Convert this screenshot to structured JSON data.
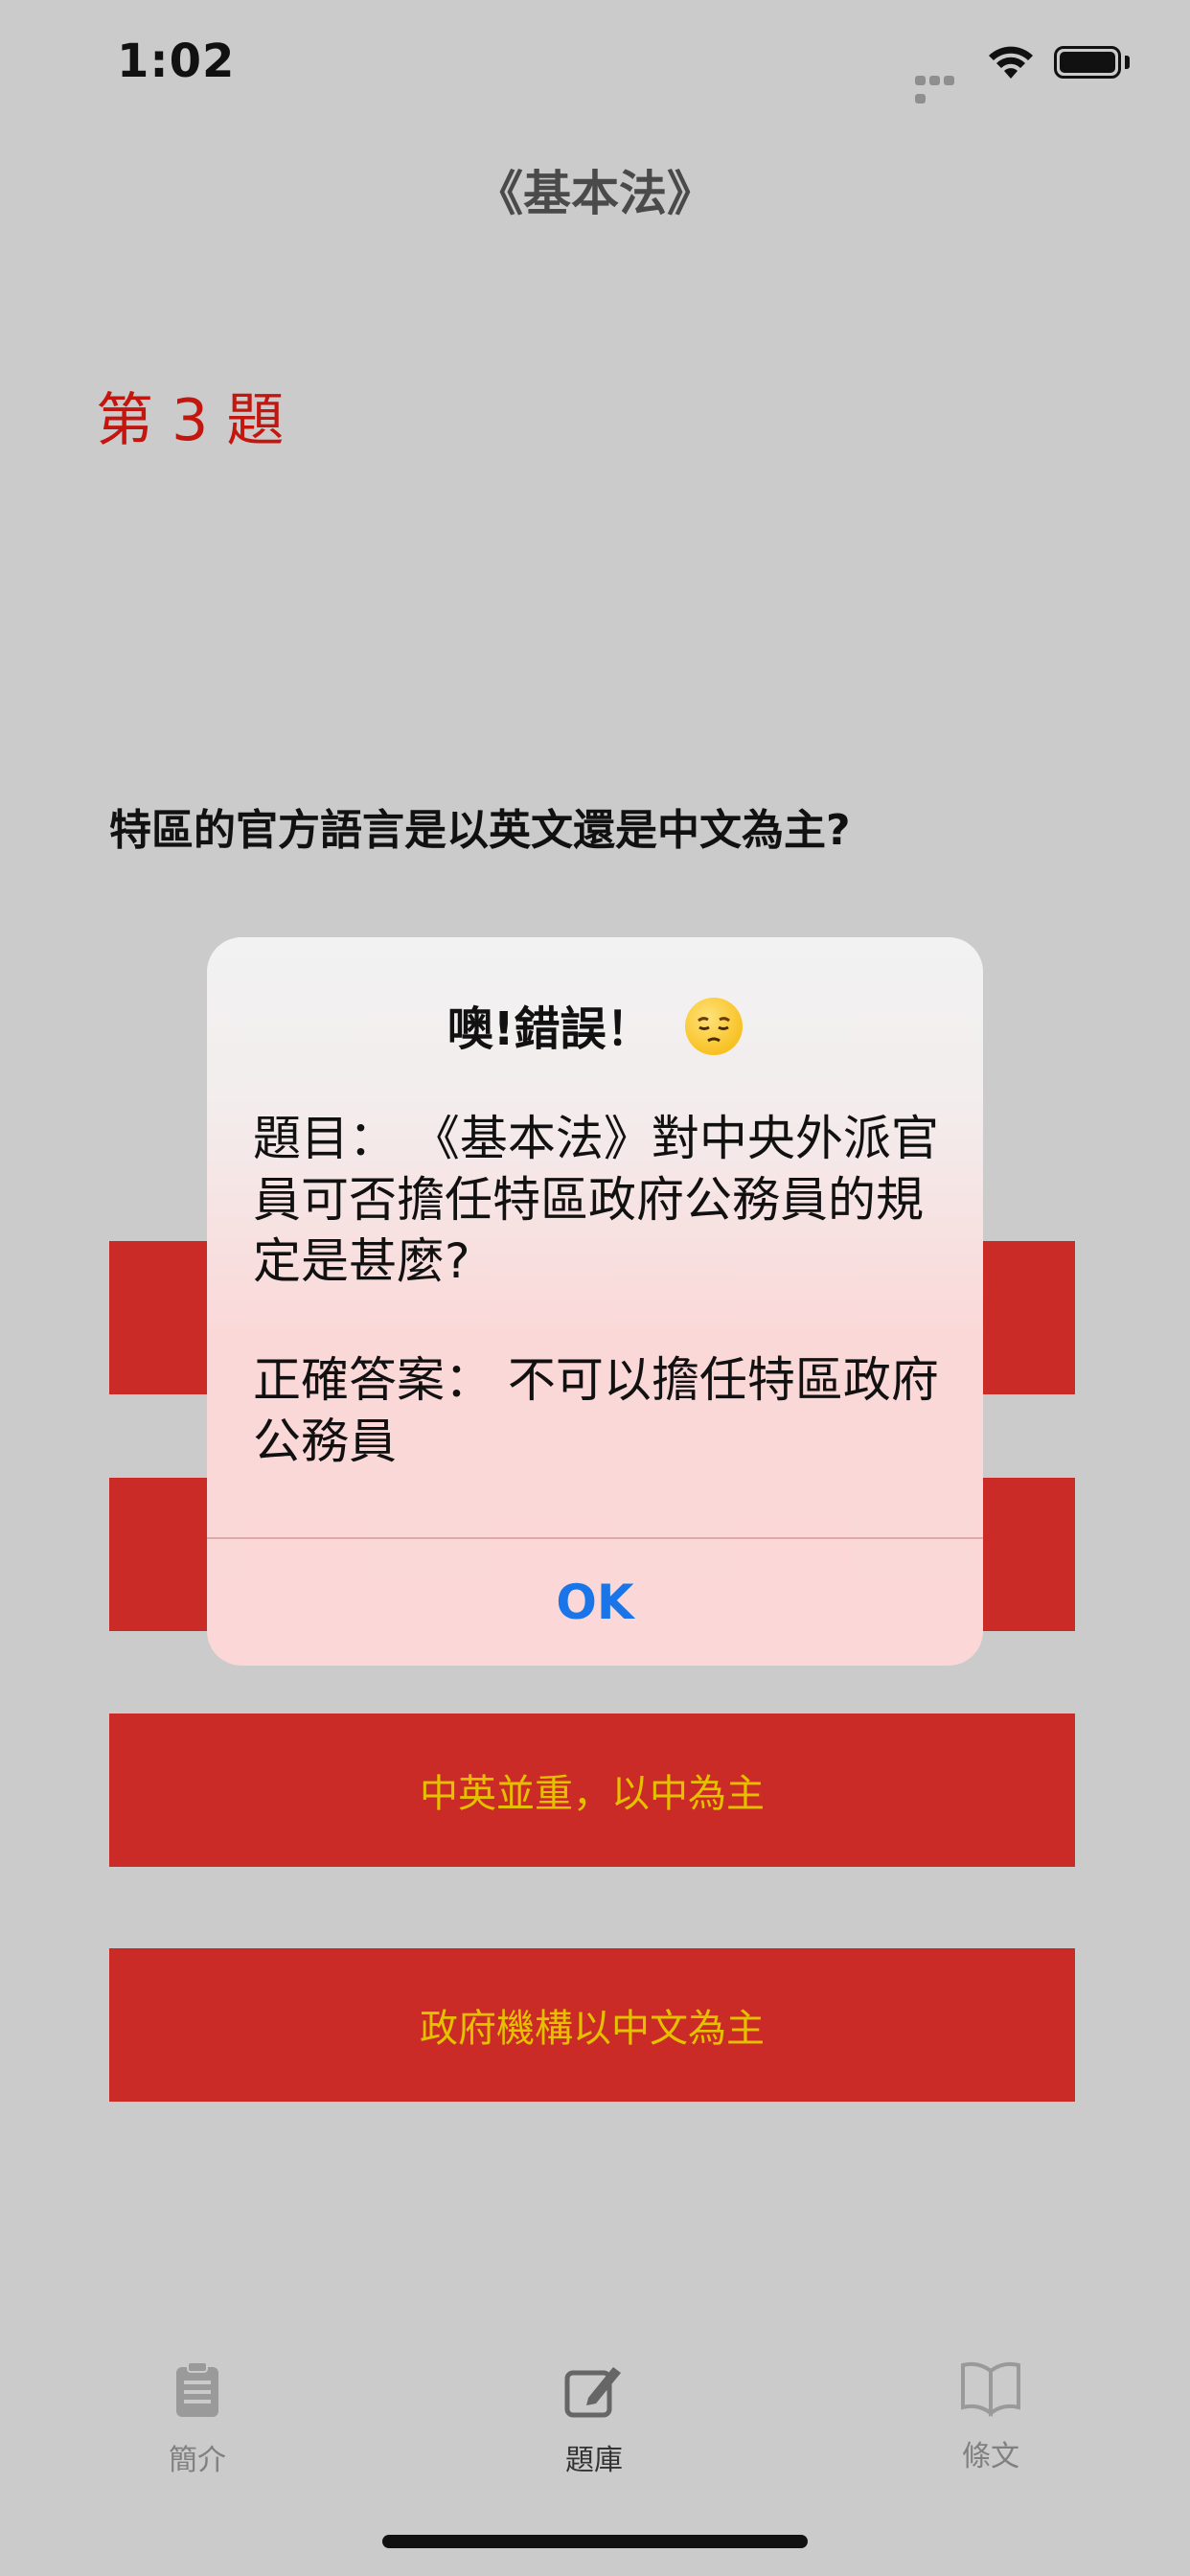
{
  "status_bar": {
    "time": "1:02"
  },
  "nav": {
    "title": "《基本法》"
  },
  "quiz": {
    "question_number": "第 3 題",
    "question": "特區的官方語言是以英文還是中文為主?",
    "answers": [
      "",
      "",
      "中英並重，以中為主",
      "政府機構以中文為主"
    ]
  },
  "alert": {
    "title": "噢!錯誤！",
    "emoji": "pensive-face",
    "message_question": "題目：  《基本法》對中央外派官員可否擔任特區政府公務員的規定是甚麼?",
    "message_answer": "正確答案：  不可以擔任特區政府公務員",
    "ok_label": "OK"
  },
  "tabbar": {
    "items": [
      {
        "label": "簡介",
        "icon": "clipboard-icon",
        "active": false
      },
      {
        "label": "題庫",
        "icon": "edit-icon",
        "active": true
      },
      {
        "label": "條文",
        "icon": "book-icon",
        "active": false
      }
    ]
  },
  "colors": {
    "background": "#cbcbcb",
    "answer_bg": "#cb2b26",
    "answer_text": "#e5c000",
    "question_number": "#c3160f",
    "alert_button": "#1a76e8"
  }
}
